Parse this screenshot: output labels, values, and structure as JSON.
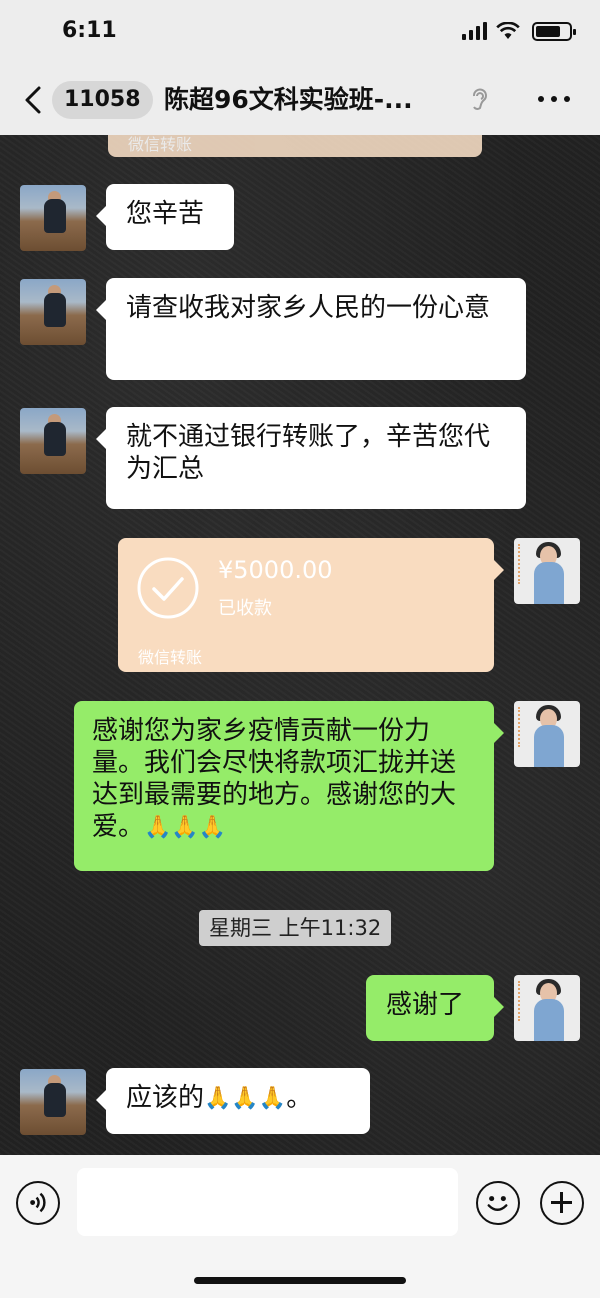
{
  "status_bar": {
    "time": "6:11"
  },
  "header": {
    "unread_count": "11058",
    "title": "陈超96文科实验班-..."
  },
  "messages": [
    {
      "side": "left",
      "text": "您辛苦"
    },
    {
      "side": "left",
      "text": "请查收我对家乡人民的一份心意"
    },
    {
      "side": "left",
      "text": "就不通过银行转账了，辛苦您代为汇总"
    },
    {
      "side": "right",
      "type": "transfer",
      "amount": "¥5000.00",
      "status": "已收款",
      "label": "微信转账"
    },
    {
      "side": "right",
      "text": "感谢您为家乡疫情贡献一份力量。我们会尽快将款项汇拢并送达到最需要的地方。感谢您的大爱。"
    },
    {
      "side": "right",
      "text": "感谢了"
    },
    {
      "side": "left",
      "text": "应该的"
    }
  ],
  "previous_transfer_label": "微信转账",
  "timestamp": "星期三 上午11:32",
  "emoji": {
    "pray": "🙏",
    "suffix": "。"
  },
  "colors": {
    "green_bubble": "#95ec69",
    "transfer_card": "#f9dcc0"
  },
  "icons": {
    "voice": "voice-icon",
    "emoji": "emoji-icon",
    "plus": "plus-icon",
    "back": "back-arrow-icon",
    "more": "more-icon",
    "ear": "ear-icon"
  }
}
